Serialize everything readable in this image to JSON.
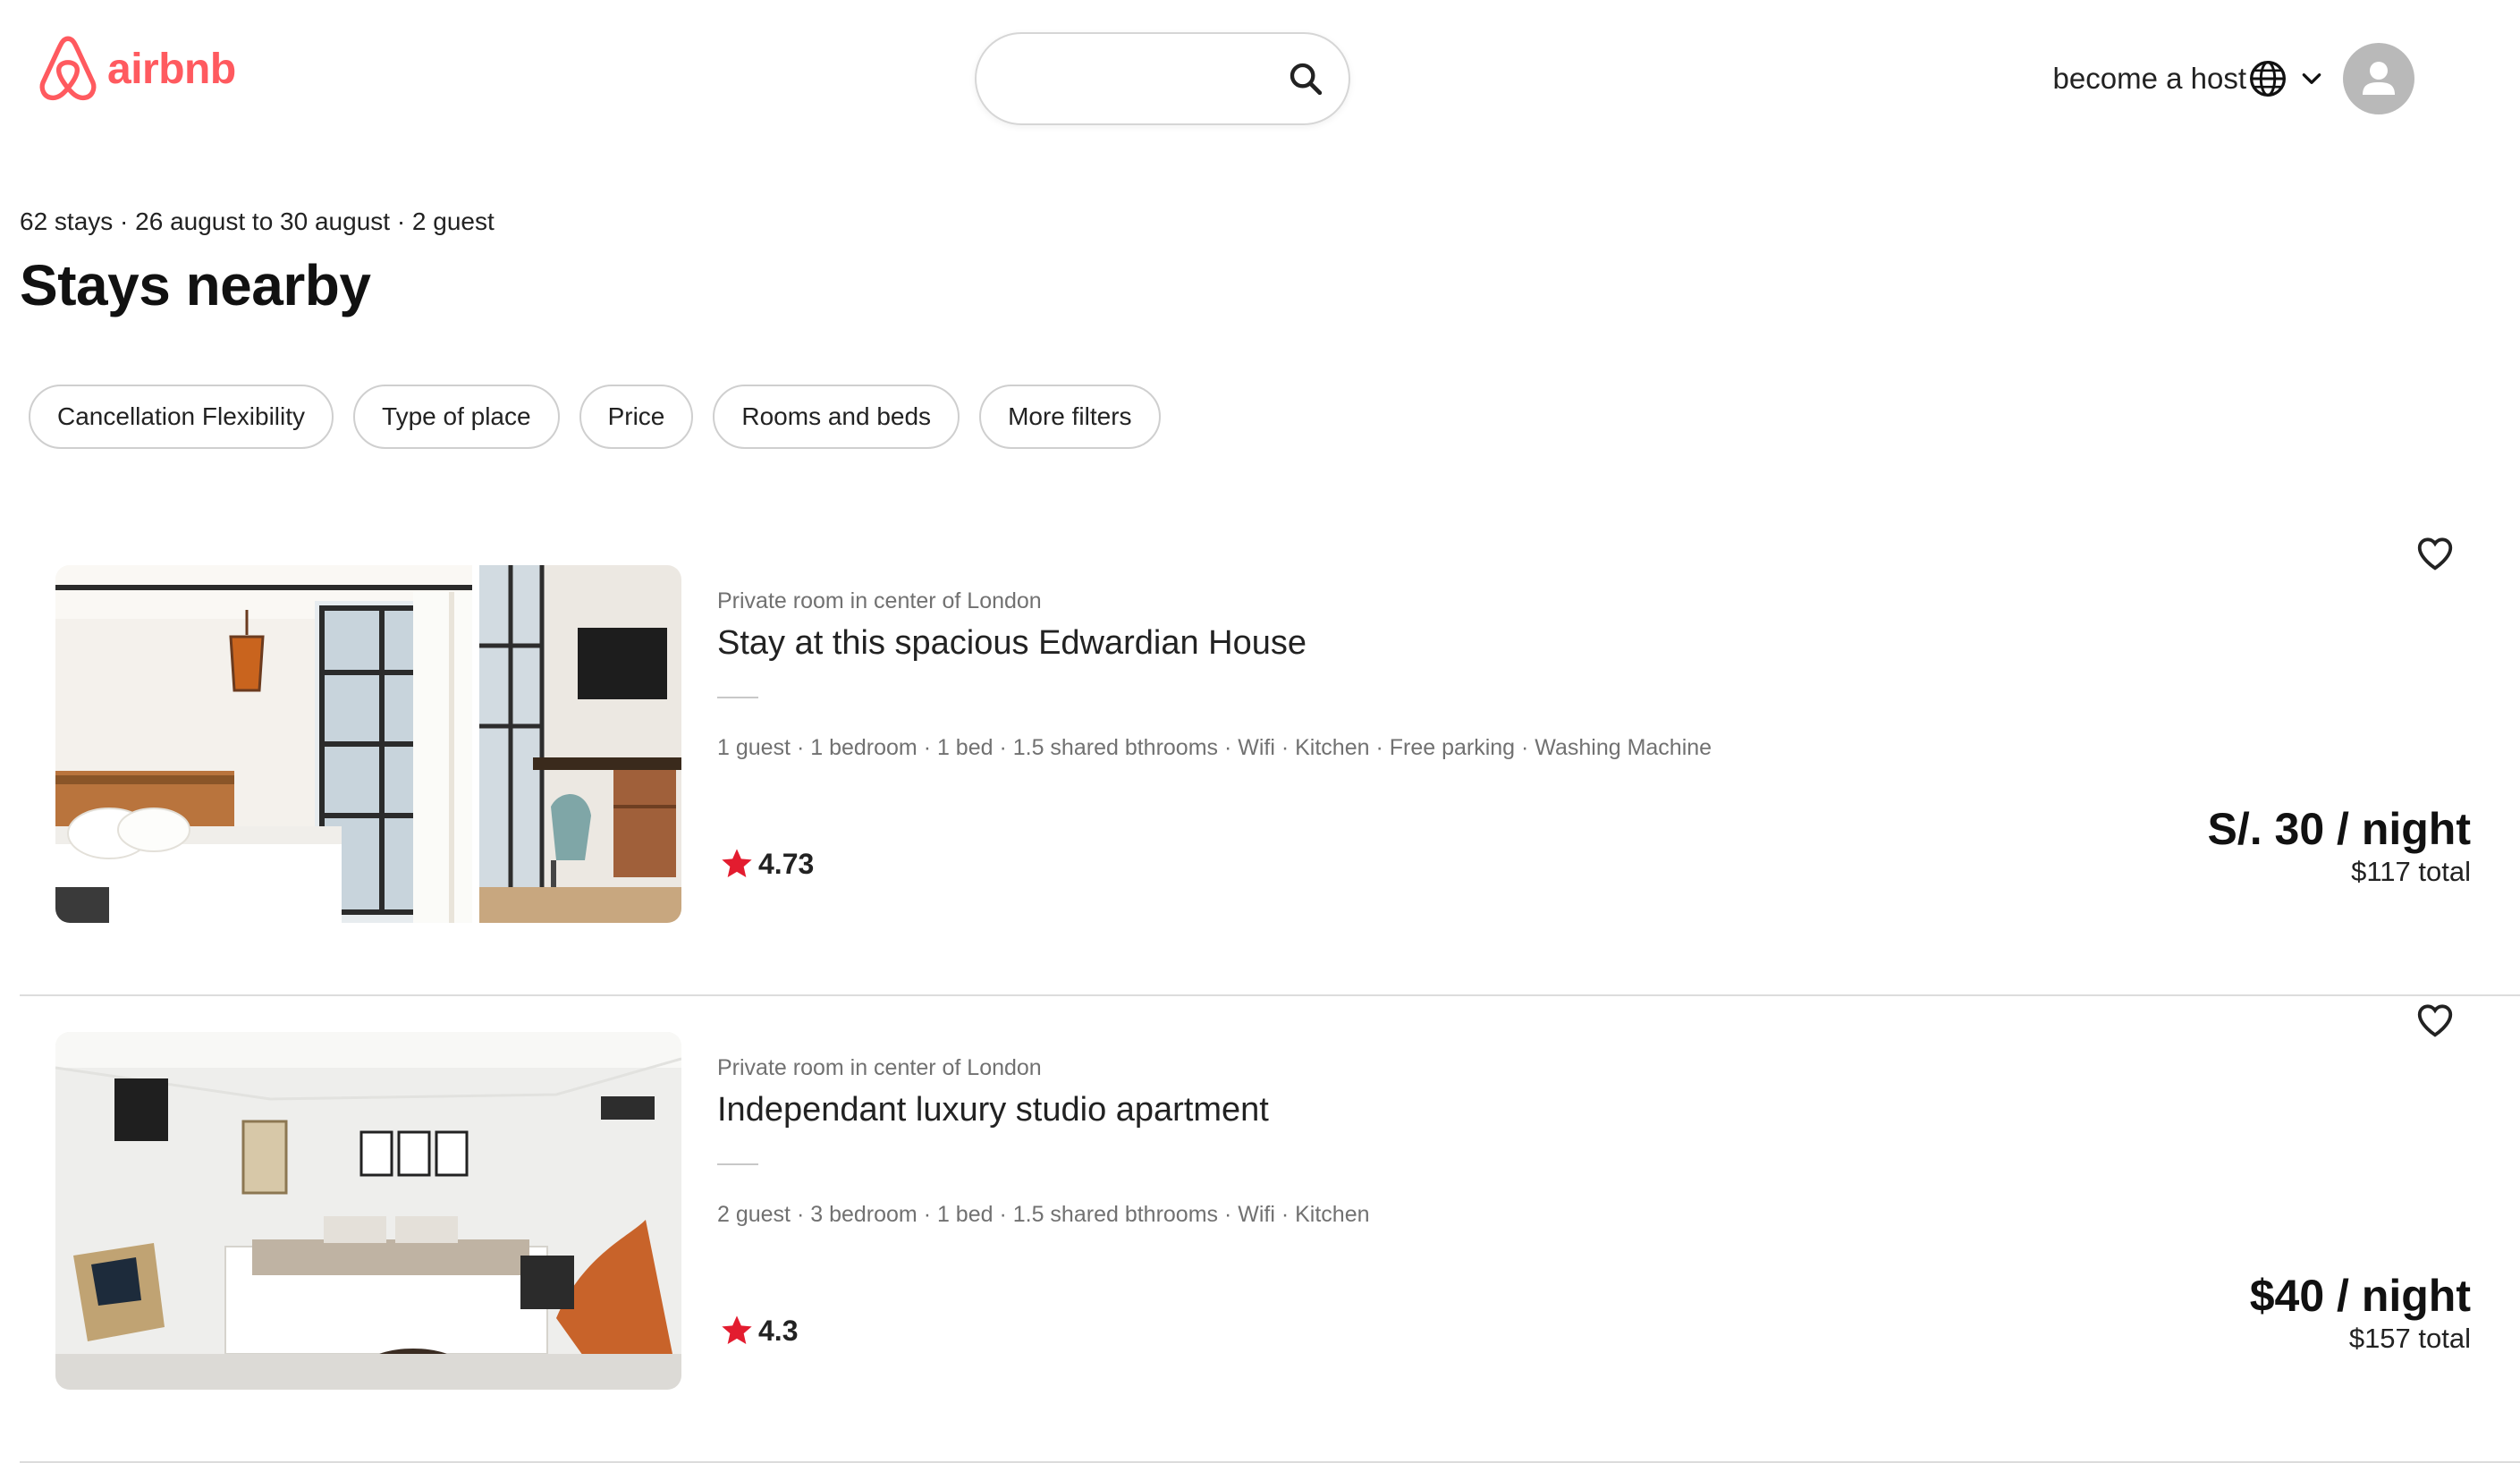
{
  "brand": {
    "name": "airbnb",
    "color": "#FF5A5F"
  },
  "header": {
    "search_placeholder": "",
    "search_icon": "search-icon",
    "host_link": "become a host",
    "language_icon": "globe-icon",
    "menu_icon": "chevron-down-icon",
    "profile_icon": "user-avatar-icon"
  },
  "summary": {
    "subtitle": "62 stays · 26 august to 30 august · 2 guest",
    "title": "Stays nearby"
  },
  "filters": [
    "Cancellation Flexibility",
    "Type of place",
    "Price",
    "Rooms and beds",
    "More filters"
  ],
  "listings": [
    {
      "room_type": "Private room in center of London",
      "title": "Stay at this spacious Edwardian House",
      "amenities": "1 guest · 1 bedroom · 1 bed · 1.5 shared bthrooms · Wifi · Kitchen · Free parking · Washing Machine",
      "rating": "4.73",
      "price": "S/. 30 / night",
      "total": "$117 total"
    },
    {
      "room_type": "Private room in center of London",
      "title": "Independant luxury studio apartment",
      "amenities": "2 guest · 3 bedroom · 1 bed · 1.5 shared bthrooms · Wifi · Kitchen",
      "rating": "4.3",
      "price": "$40 / night",
      "total": "$157 total"
    }
  ],
  "colors": {
    "star": "#E31C2F",
    "muted_text": "#717171",
    "border": "#cfcfcf"
  }
}
